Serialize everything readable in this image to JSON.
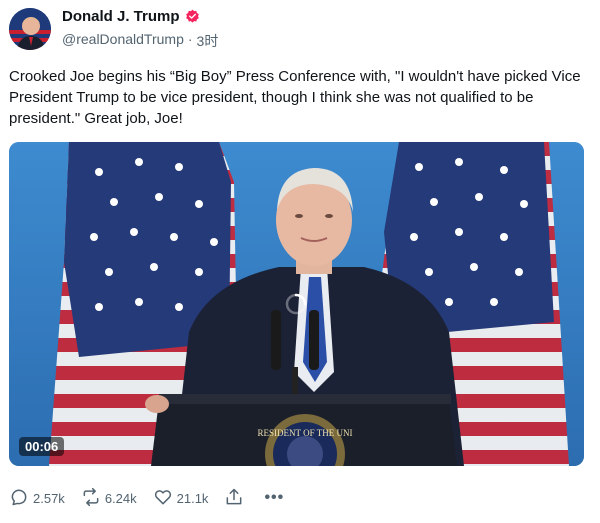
{
  "post": {
    "author_name": "Donald J. Trump",
    "handle": "@realDonaldTrump",
    "separator": "·",
    "time": "3时",
    "text": "Crooked Joe begins his “Big Boy” Press Conference with, \"I wouldn't have picked Vice President Trump to be vice president, though I think she was not qualified to be president.\" Great job, Joe!",
    "verified_color": "#f4245e",
    "media": {
      "duration": "00:06",
      "seal_text": "RESIDENT OF THE UNI"
    },
    "actions": {
      "replies": "2.57k",
      "reposts": "6.24k",
      "likes": "21.1k",
      "more_label": "•••"
    },
    "icons": [
      "verified-badge-icon",
      "reply-icon",
      "repost-icon",
      "like-icon",
      "share-icon",
      "more-icon",
      "loading-spinner-icon"
    ]
  }
}
